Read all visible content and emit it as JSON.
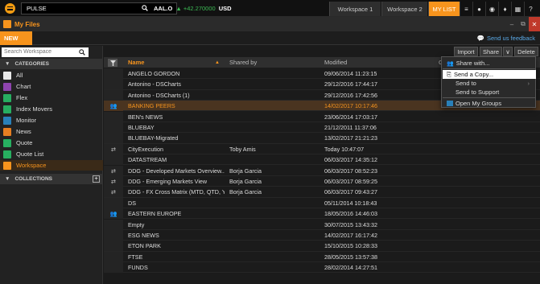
{
  "topbar": {
    "command_value": "PULSE",
    "ticker_symbol": "AAL.O",
    "ticker_change": "+42.270000",
    "ticker_currency": "USD",
    "tabs": [
      {
        "label": "Workspace 1"
      },
      {
        "label": "Workspace 2"
      },
      {
        "label": "MY LIST"
      }
    ]
  },
  "window": {
    "title": "My Files"
  },
  "actions": {
    "new_label": "NEW",
    "feedback_label": "Send us feedback"
  },
  "sidebar": {
    "search_placeholder": "Search Workspace",
    "categories_label": "CATEGORIES",
    "collections_label": "COLLECTIONS",
    "categories": [
      {
        "label": "All",
        "color": "#e8e8e8"
      },
      {
        "label": "Chart",
        "color": "#8e44ad"
      },
      {
        "label": "Flex",
        "color": "#27ae60"
      },
      {
        "label": "Index Movers",
        "color": "#27ae60"
      },
      {
        "label": "Monitor",
        "color": "#2980b9"
      },
      {
        "label": "News",
        "color": "#e67e22"
      },
      {
        "label": "Quote",
        "color": "#27ae60"
      },
      {
        "label": "Quote List",
        "color": "#27ae60"
      },
      {
        "label": "Workspace",
        "color": "#f7941d"
      }
    ]
  },
  "toolbar": {
    "import_label": "Import",
    "share_label": "Share",
    "delete_label": "Delete"
  },
  "table": {
    "headers": {
      "name": "Name",
      "shared_by": "Shared by",
      "modified": "Modified",
      "extra": "C"
    },
    "rows": [
      {
        "icon": "",
        "name": "ANGELO GORDON",
        "shared": "",
        "modified": "09/06/2014 11:23:15"
      },
      {
        "icon": "",
        "name": "Antonino - DSCharts",
        "shared": "",
        "modified": "29/12/2016 17:44:17"
      },
      {
        "icon": "",
        "name": "Antonino - DSCharts (1)",
        "shared": "",
        "modified": "29/12/2016 17:42:56"
      },
      {
        "icon": "group",
        "name": "BANKING PEERS",
        "shared": "",
        "modified": "14/02/2017 10:17:46",
        "selected": true
      },
      {
        "icon": "",
        "name": "BEN's NEWS",
        "shared": "",
        "modified": "23/06/2014 17:03:17"
      },
      {
        "icon": "",
        "name": "BLUEBAY",
        "shared": "",
        "modified": "21/12/2011 11:37:06"
      },
      {
        "icon": "",
        "name": "BLUEBAY-Migrated",
        "shared": "",
        "modified": "13/02/2017 21:21:23"
      },
      {
        "icon": "share",
        "name": "CityExecution",
        "shared": "Toby Amis",
        "modified": "Today 10:47:07"
      },
      {
        "icon": "",
        "name": "DATASTREAM",
        "shared": "",
        "modified": "06/03/2017 14:35:12"
      },
      {
        "icon": "share",
        "name": "DDG - Developed Markets Overview...",
        "shared": "Borja Garcia",
        "modified": "06/03/2017 08:52:23"
      },
      {
        "icon": "share",
        "name": "DDG - Emerging Markets View",
        "shared": "Borja Garcia",
        "modified": "06/03/2017 08:59:25"
      },
      {
        "icon": "share",
        "name": "DDG - FX Cross Matrix (MTD, QTD, Y...",
        "shared": "Borja Garcia",
        "modified": "06/03/2017 09:43:27"
      },
      {
        "icon": "",
        "name": "DS",
        "shared": "",
        "modified": "05/11/2014 10:18:43"
      },
      {
        "icon": "group",
        "name": "EASTERN EUROPE",
        "shared": "",
        "modified": "18/05/2016 14:46:03"
      },
      {
        "icon": "",
        "name": "Empty",
        "shared": "",
        "modified": "30/07/2015 13:43:32"
      },
      {
        "icon": "",
        "name": "ESG NEWS",
        "shared": "",
        "modified": "14/02/2017 16:17:42"
      },
      {
        "icon": "",
        "name": "ETON PARK",
        "shared": "",
        "modified": "15/10/2015 10:28:33"
      },
      {
        "icon": "",
        "name": "FTSE",
        "shared": "",
        "modified": "28/05/2015 13:57:38"
      },
      {
        "icon": "",
        "name": "FUNDS",
        "shared": "",
        "modified": "28/02/2014 14:27:51"
      }
    ]
  },
  "menu": {
    "share_with": "Share with...",
    "send_copy": "Send a Copy...",
    "send_to": "Send to",
    "send_support": "Send to Support",
    "open_groups": "Open My Groups"
  }
}
